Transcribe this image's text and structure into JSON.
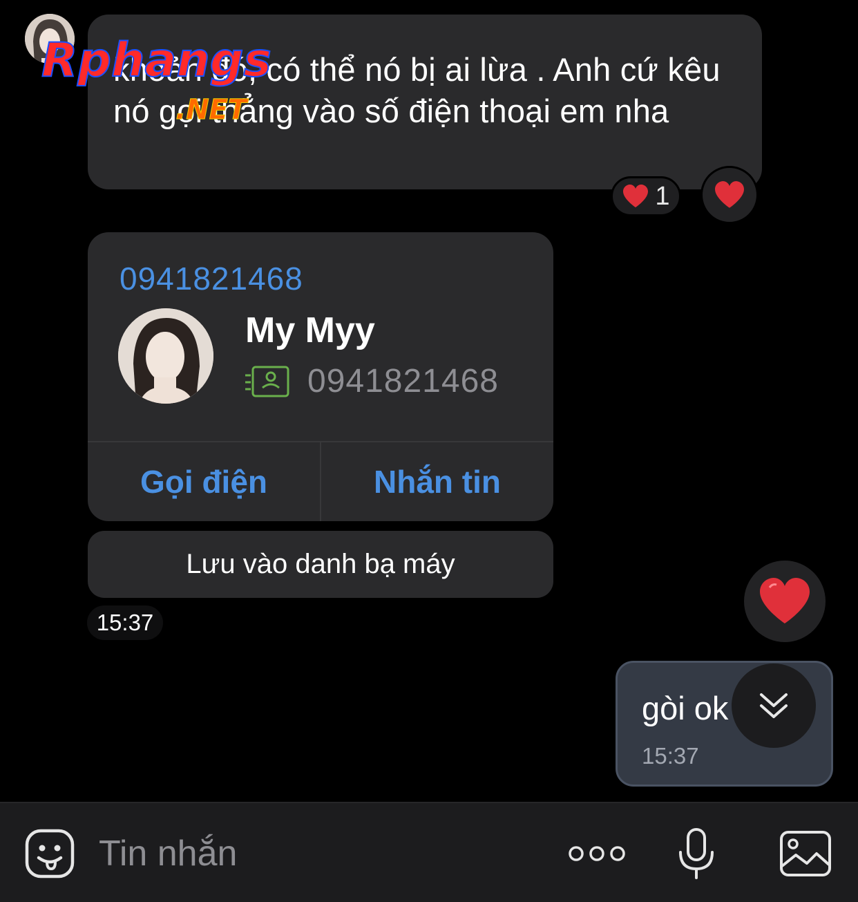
{
  "conversation": {
    "received_text": "khoản đó, có thể nó bị ai lừa . Anh cứ kêu nó gọi thẳng vào số điện thoại em nha",
    "received_reactions": {
      "emoji": "heart",
      "count": "1"
    },
    "watermark": {
      "brand": "Rphangs",
      "suffix": ".NET"
    },
    "contact_card": {
      "number_link": "0941821468",
      "name": "My Myy",
      "phone": "0941821468",
      "call_label": "Gọi điện",
      "message_label": "Nhắn tin"
    },
    "save_contact_label": "Lưu vào danh bạ máy",
    "received_time": "15:37",
    "sent_text": "gòi ok",
    "sent_time": "15:37"
  },
  "input_bar": {
    "placeholder": "Tin nhắn",
    "icons": [
      "sticker-icon",
      "more-icon",
      "microphone-icon",
      "image-icon"
    ]
  },
  "colors": {
    "background": "#000000",
    "bubble_in": "#2a2a2c",
    "bubble_out": "#343a45",
    "link_blue": "#4a90e2",
    "heart": "#e0303a",
    "id_icon_green": "#6ab04c"
  }
}
